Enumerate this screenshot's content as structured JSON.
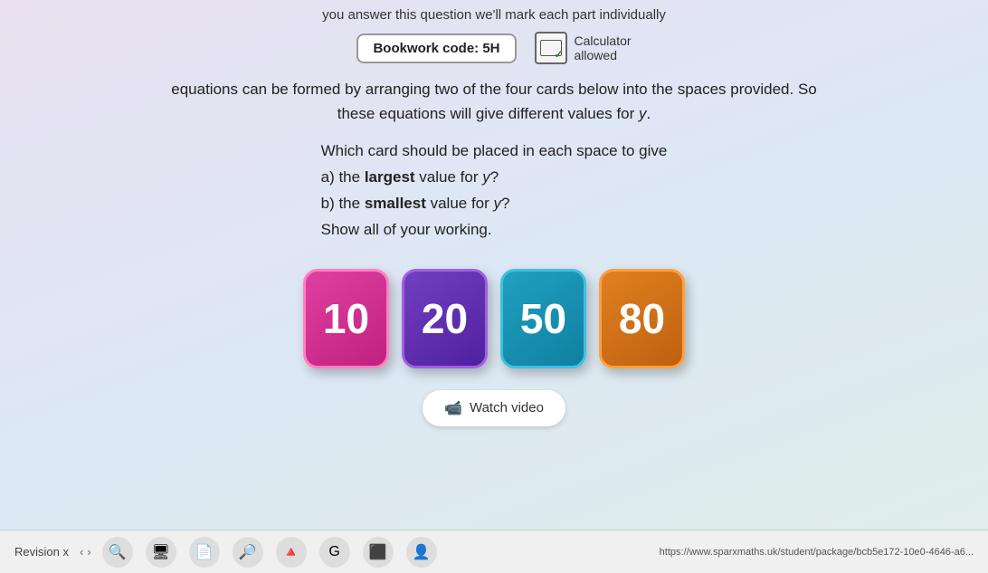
{
  "header": {
    "top_notice": "you answer this question we'll mark each part individually",
    "bookwork_label": "Bookwork code: 5H",
    "calculator_label": "Calculator\nallowed"
  },
  "main": {
    "intro_line1": "equations can be formed by arranging two of the four cards below into the spaces provided. So",
    "intro_line2": "these equations will give different values for y.",
    "question_prompt": "Which card should be placed in each space to give",
    "part_a": "a) the largest value for y?",
    "part_b": "b) the smallest value for y?",
    "part_show": "Show all of your working."
  },
  "cards": [
    {
      "value": "10",
      "color_class": "card-pink"
    },
    {
      "value": "20",
      "color_class": "card-purple"
    },
    {
      "value": "50",
      "color_class": "card-cyan"
    },
    {
      "value": "80",
      "color_class": "card-orange"
    }
  ],
  "watch_video_label": "Watch video",
  "bottom": {
    "revision_label": "Revision x",
    "url": "https://www.sparxmaths.uk/student/package/bcb5e172-10e0-4646-a6..."
  }
}
